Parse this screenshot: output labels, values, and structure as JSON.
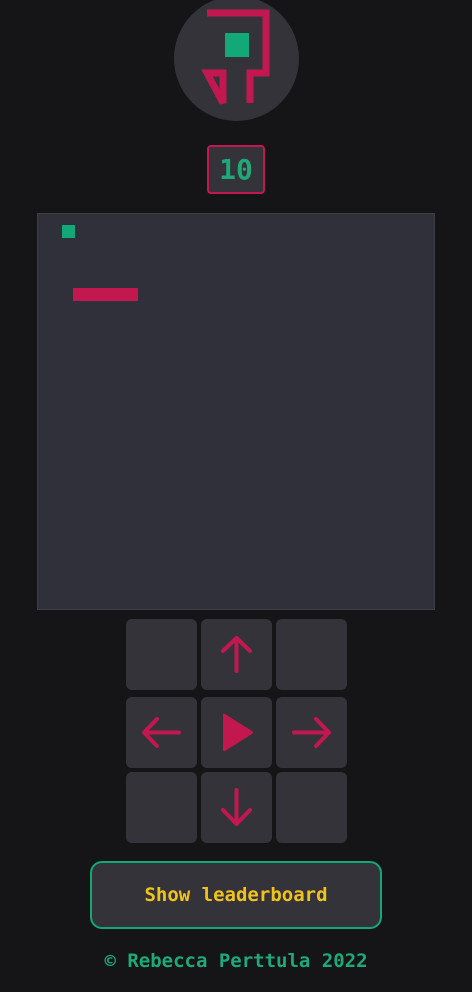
{
  "logo": {
    "icon": "snake-logo-icon"
  },
  "score": {
    "value": "10"
  },
  "board": {
    "food_icon": "food-square-icon",
    "snake_icon": "snake-body"
  },
  "controls": {
    "up_icon": "arrow-up-icon",
    "left_icon": "arrow-left-icon",
    "play_icon": "play-icon",
    "right_icon": "arrow-right-icon",
    "down_icon": "arrow-down-icon"
  },
  "leaderboard_button": {
    "label": "Show leaderboard"
  },
  "footer": {
    "text": "© Rebecca Perttula 2022"
  },
  "colors": {
    "background": "#151517",
    "panel": "#333339",
    "accent_red": "#c2184f",
    "accent_green": "#12a878",
    "accent_yellow": "#f2c21c"
  }
}
